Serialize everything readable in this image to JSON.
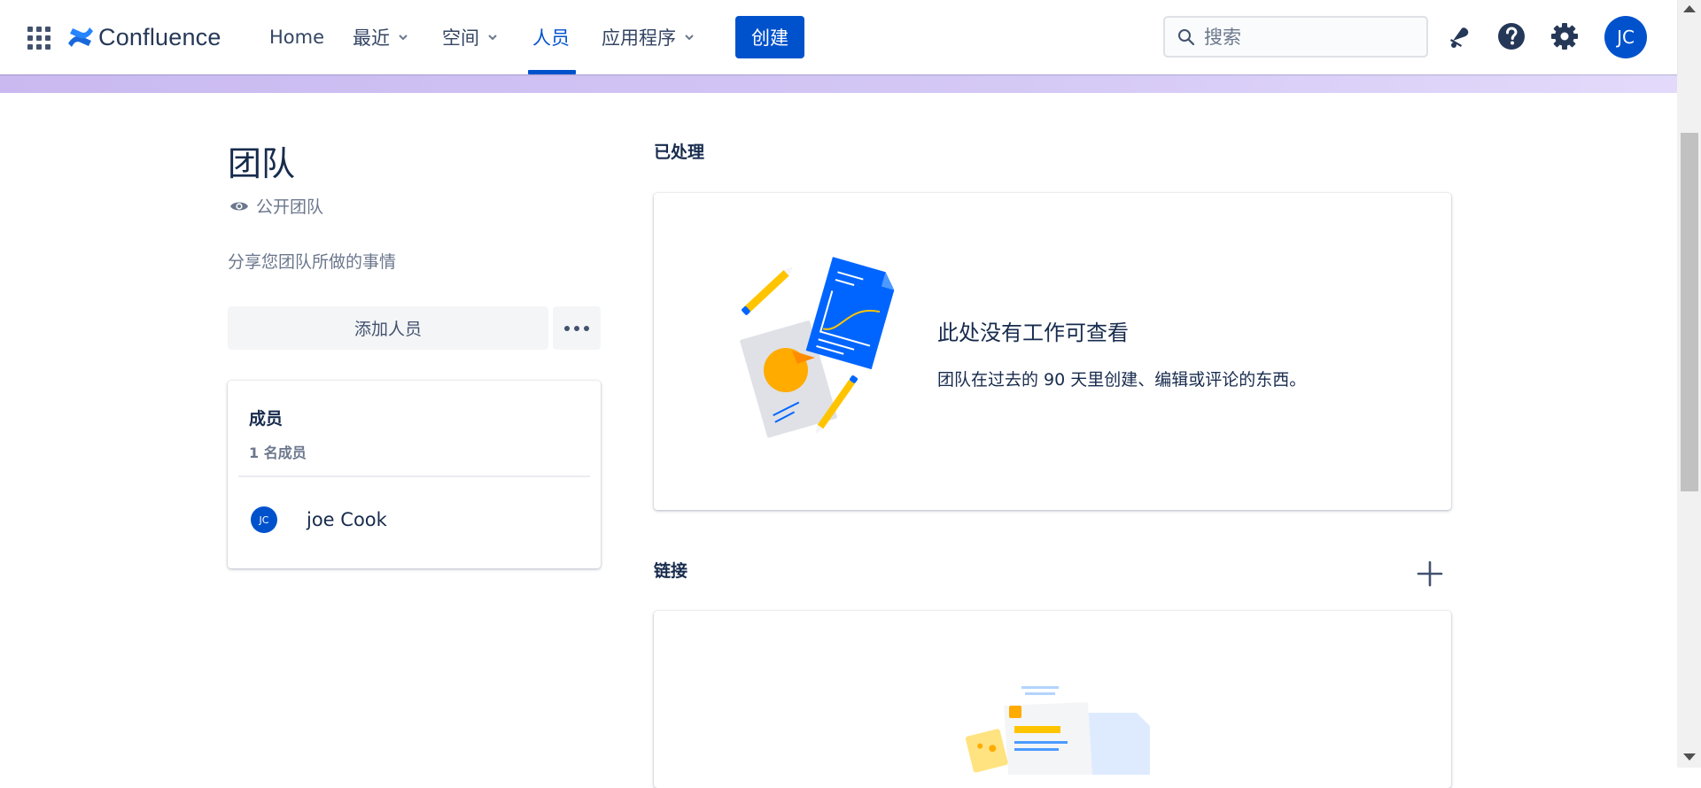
{
  "app": {
    "name": "Confluence",
    "brand_color": "#0052cc"
  },
  "topnav": {
    "home": "Home",
    "recent": "最近",
    "spaces": "空间",
    "people": "人员",
    "apps": "应用程序",
    "create_label": "创建",
    "search_placeholder": "搜索",
    "user_initials": "JC"
  },
  "team": {
    "title": "团队",
    "visibility": "公开团队",
    "description": "分享您团队所做的事情",
    "add_people_label": "添加人员"
  },
  "members": {
    "title": "成员",
    "count_label": "1 名成员",
    "items": [
      {
        "initials": "JC",
        "name": "joe Cook"
      }
    ]
  },
  "work": {
    "section_title": "已处理",
    "empty_title": "此处没有工作可查看",
    "empty_desc": "团队在过去的 90 天里创建、编辑或评论的东西。"
  },
  "links": {
    "section_title": "链接"
  },
  "icons": {
    "app_switcher": "grid-icon",
    "search": "search-icon",
    "notifications": "bell-icon",
    "help": "help-icon",
    "settings": "gear-icon",
    "visibility": "eye-icon",
    "more": "more-icon",
    "add": "plus-icon"
  }
}
